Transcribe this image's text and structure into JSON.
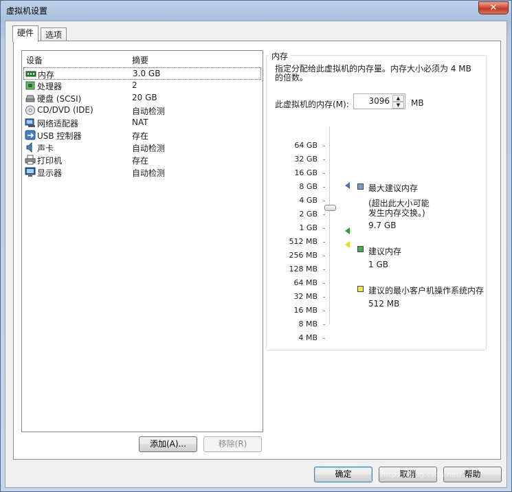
{
  "window": {
    "title": "虚拟机设置",
    "close_label": "✕"
  },
  "tabs": [
    {
      "label": "硬件"
    },
    {
      "label": "选项"
    }
  ],
  "device_list": {
    "col_device": "设备",
    "col_summary": "摘要",
    "items": [
      {
        "name": "内存",
        "summary": "3.0 GB",
        "icon": "memory-icon"
      },
      {
        "name": "处理器",
        "summary": "2",
        "icon": "processor-icon"
      },
      {
        "name": "硬盘 (SCSI)",
        "summary": "20 GB",
        "icon": "harddisk-icon"
      },
      {
        "name": "CD/DVD (IDE)",
        "summary": "自动检测",
        "icon": "cdrom-icon"
      },
      {
        "name": "网络适配器",
        "summary": "NAT",
        "icon": "network-adapter-icon"
      },
      {
        "name": "USB 控制器",
        "summary": "存在",
        "icon": "usb-icon"
      },
      {
        "name": "声卡",
        "summary": "自动检测",
        "icon": "sound-card-icon"
      },
      {
        "name": "打印机",
        "summary": "存在",
        "icon": "printer-icon"
      },
      {
        "name": "显示器",
        "summary": "自动检测",
        "icon": "display-icon"
      }
    ]
  },
  "list_buttons": {
    "add": "添加(A)...",
    "remove": "移除(R)"
  },
  "memory": {
    "group_title": "内存",
    "description": "指定分配给此虚拟机的内存量。内存大小必须为 4 MB 的倍数。",
    "field_label": "此虚拟机的内存(M):",
    "value": "3096",
    "unit": "MB",
    "scale": [
      "64 GB",
      "32 GB",
      "16 GB",
      "8 GB",
      "4 GB",
      "2 GB",
      "1 GB",
      "512 MB",
      "256 MB",
      "128 MB",
      "64 MB",
      "32 MB",
      "16 MB",
      "8 MB",
      "4 MB"
    ],
    "legend": {
      "max_title": "最大建议内存",
      "max_note_line1": "(超出此大小可能",
      "max_note_line2": "发生内存交换。)",
      "max_value": "9.7 GB",
      "rec_title": "建议内存",
      "rec_value": "1 GB",
      "min_title": "建议的最小客户机操作系统内存",
      "min_value": "512 MB"
    },
    "colors": {
      "max": "#7f9dc6",
      "recommended": "#3fb23f",
      "minimum": "#f1ea45"
    }
  },
  "footer": {
    "ok": "确定",
    "cancel": "取消",
    "help": "帮助"
  },
  "watermark": "https://blog.csdn.net/..."
}
